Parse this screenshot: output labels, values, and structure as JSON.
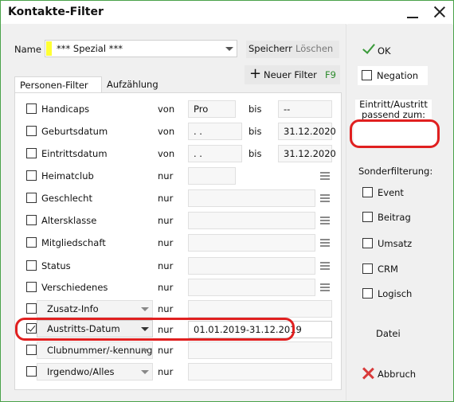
{
  "window": {
    "title": "Kontakte-Filter"
  },
  "name_field": {
    "label": "Name",
    "value": "*** Spezial ***"
  },
  "toolbar": {
    "save_label": "Speichern",
    "delete_label": "Löschen",
    "new_filter_label": "Neuer Filter",
    "new_filter_shortcut": "F9"
  },
  "tabs": [
    {
      "label": "Personen-Filter"
    },
    {
      "label": "Aufzählung"
    }
  ],
  "rows": [
    {
      "label": "Handicaps",
      "op": "von",
      "from": "Pro",
      "to_label": "bis",
      "to": "--"
    },
    {
      "label": "Geburtsdatum",
      "op": "von",
      "from": ". .",
      "to_label": "bis",
      "to": "31.12.2020"
    },
    {
      "label": "Eintrittsdatum",
      "op": "von",
      "from": ". .",
      "to_label": "bis",
      "to": "31.12.2020"
    },
    {
      "label": "Heimatclub",
      "op": "nur",
      "value": ""
    },
    {
      "label": "Geschlecht",
      "op": "nur",
      "value": ""
    },
    {
      "label": "Altersklasse",
      "op": "nur",
      "value": ""
    },
    {
      "label": "Mitgliedschaft",
      "op": "nur",
      "value": ""
    },
    {
      "label": "Status",
      "op": "nur",
      "value": ""
    },
    {
      "label": "Verschiedenes",
      "op": "nur",
      "value": ""
    },
    {
      "label": "Zusatz-Info",
      "op": "nur",
      "value": "",
      "checked": false
    },
    {
      "label": "Austritts-Datum",
      "op": "nur",
      "value": "01.01.2019-31.12.2019",
      "checked": true
    },
    {
      "label": "Clubnummer/-kennung",
      "op": "nur",
      "value": "",
      "checked": false
    },
    {
      "label": "Irgendwo/Alles",
      "op": "nur",
      "value": "",
      "checked": false
    }
  ],
  "right": {
    "ok_label": "OK",
    "negation_label": "Negation",
    "eintritt_label": "Eintritt/Austritt passend zum:",
    "sonder_label": "Sonderfilterung:",
    "sonder_items": [
      "Event",
      "Beitrag",
      "Umsatz",
      "CRM",
      "Logisch"
    ],
    "datei_label": "Datei",
    "abbruch_label": "Abbruch"
  },
  "colors": {
    "accent_green": "#4aa24a",
    "highlight_red": "#e02020",
    "name_marker_yellow": "#ffff33"
  }
}
